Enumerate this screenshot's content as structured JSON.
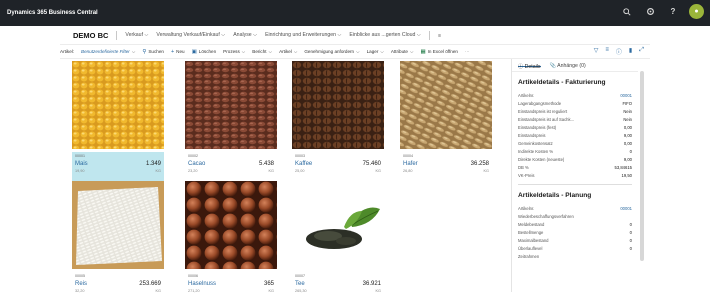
{
  "app": {
    "title": "Dynamics 365 Business Central"
  },
  "topbar_icons": [
    "search-icon",
    "settings-icon",
    "help-icon",
    "avatar"
  ],
  "nav": {
    "company": "DEMO BC",
    "items": [
      "Verkauf",
      "Verwaltung Verkauf/Einkauf",
      "Analyse",
      "Einrichtung und Erweiterungen",
      "Einblicke aus ...gerten Cloud"
    ]
  },
  "commands": {
    "section_label": "Artikel:",
    "filter_label": "Benutzerdefinierte Filter",
    "search": "Suchen",
    "new": "Neu",
    "delete": "Löschen",
    "process": "Prozess",
    "report": "Bericht",
    "item": "Artikel",
    "approval": "Genehmigung anfordern",
    "warehouse": "Lager",
    "attributes": "Attribute",
    "excel": "In Excel öffnen"
  },
  "tiles": [
    {
      "no": "00001",
      "name": "Mais",
      "qty": "1.349",
      "price": "19,90",
      "unit": "KG",
      "image": "corn",
      "selected": true
    },
    {
      "no": "00002",
      "name": "Cacao",
      "qty": "5.438",
      "price": "23,20",
      "unit": "KG",
      "image": "cocoa-beans"
    },
    {
      "no": "00003",
      "name": "Kaffee",
      "qty": "75.460",
      "price": "25,00",
      "unit": "KG",
      "image": "coffee-beans"
    },
    {
      "no": "00004",
      "name": "Hafer",
      "qty": "36.258",
      "price": "26,80",
      "unit": "KG",
      "image": "oats"
    },
    {
      "no": "00005",
      "name": "Reis",
      "qty": "253.669",
      "price": "32,20",
      "unit": "KG",
      "image": "rice"
    },
    {
      "no": "00006",
      "name": "Haselnuss",
      "qty": "365",
      "price": "271,20",
      "unit": "KG",
      "image": "hazelnuts"
    },
    {
      "no": "00007",
      "name": "Tee",
      "qty": "36.921",
      "price": "265,30",
      "unit": "KG",
      "image": "tea-leaves"
    }
  ],
  "factbox": {
    "tabs": [
      "Details",
      "Anhänge (0)"
    ],
    "section1_title": "Artikeldetails - Fakturierung",
    "section1_rows": [
      {
        "label": "Artikelnr.",
        "value": "00001",
        "link": true
      },
      {
        "label": "Lagerabgangsmethode",
        "value": "FIFO"
      },
      {
        "label": "Einstandspreis ist reguliert",
        "value": "Nein"
      },
      {
        "label": "Einstandspreis ist auf Sachk...",
        "value": "Nein"
      },
      {
        "label": "Einstandspreis (fest)",
        "value": "0,00"
      },
      {
        "label": "Einstandspreis",
        "value": "9,00"
      },
      {
        "label": "Gemeinkostensatz",
        "value": "0,00"
      },
      {
        "label": "Indirekte Kosten %",
        "value": "0"
      },
      {
        "label": "Direkte Kosten (neueste)",
        "value": "9,00"
      },
      {
        "label": "DB %",
        "value": "53,84615"
      },
      {
        "label": "VK-Preis",
        "value": "19,50"
      }
    ],
    "section2_title": "Artikeldetails - Planung",
    "section2_rows": [
      {
        "label": "Artikelnr.",
        "value": "00001",
        "link": true
      },
      {
        "label": "Wiederbeschaffungsverfahren",
        "value": ""
      },
      {
        "label": "Meldebestand",
        "value": "0"
      },
      {
        "label": "Bestellmenge",
        "value": "0"
      },
      {
        "label": "Maximalbestand",
        "value": "0"
      },
      {
        "label": "Überlauflevel",
        "value": "0"
      },
      {
        "label": "Zeitrahmen",
        "value": ""
      }
    ]
  },
  "colors": {
    "topbar": "#1f2328",
    "accent": "#2c6aa0",
    "selected_tile": "#bfe6ee"
  }
}
